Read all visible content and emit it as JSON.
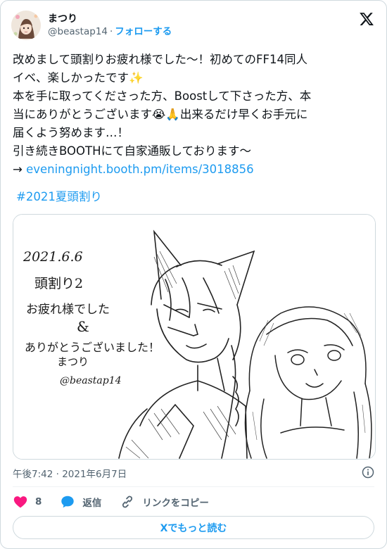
{
  "author": {
    "display_name": "まつり",
    "handle": "@beastap14",
    "separator": "·",
    "follow_label": "フォローする"
  },
  "tweet": {
    "line1": "改めまして頭割りお疲れ様でした〜！初めてのFF14同人",
    "line2": "イベ、楽しかったです✨",
    "line3": "本を手に取ってくださった方、Boostして下さった方、本",
    "line4": "当にありがとうございます😭🙏出来るだけ早くお手元に",
    "line5": "届くよう努めます…！",
    "line6": "引き続きBOOTHにて自家通販しております〜",
    "arrow": "→ ",
    "link": "eveningnight.booth.pm/items/3018856",
    "hashtag": "#2021夏頭割り"
  },
  "image_text": {
    "date": "2021.6.6",
    "event": "頭割り2",
    "thanks1": "お疲れ様でした",
    "amp": "&",
    "thanks2": "ありがとうございました！",
    "signature": "まつり",
    "sig_handle": "@beastap14"
  },
  "meta": {
    "timestamp": "午後7:42 · 2021年6月7日"
  },
  "actions": {
    "like_count": "8",
    "reply_label": "返信",
    "copy_link_label": "リンクをコピー"
  },
  "read_more_label": "Xでもっと読む",
  "colors": {
    "accent": "#1d9bf0",
    "like": "#f91880",
    "text": "#0f1419",
    "secondary": "#536471",
    "border": "#cfd9de"
  },
  "icons": [
    "x-logo-icon",
    "info-icon",
    "heart-icon",
    "reply-bubble-icon",
    "link-icon"
  ]
}
